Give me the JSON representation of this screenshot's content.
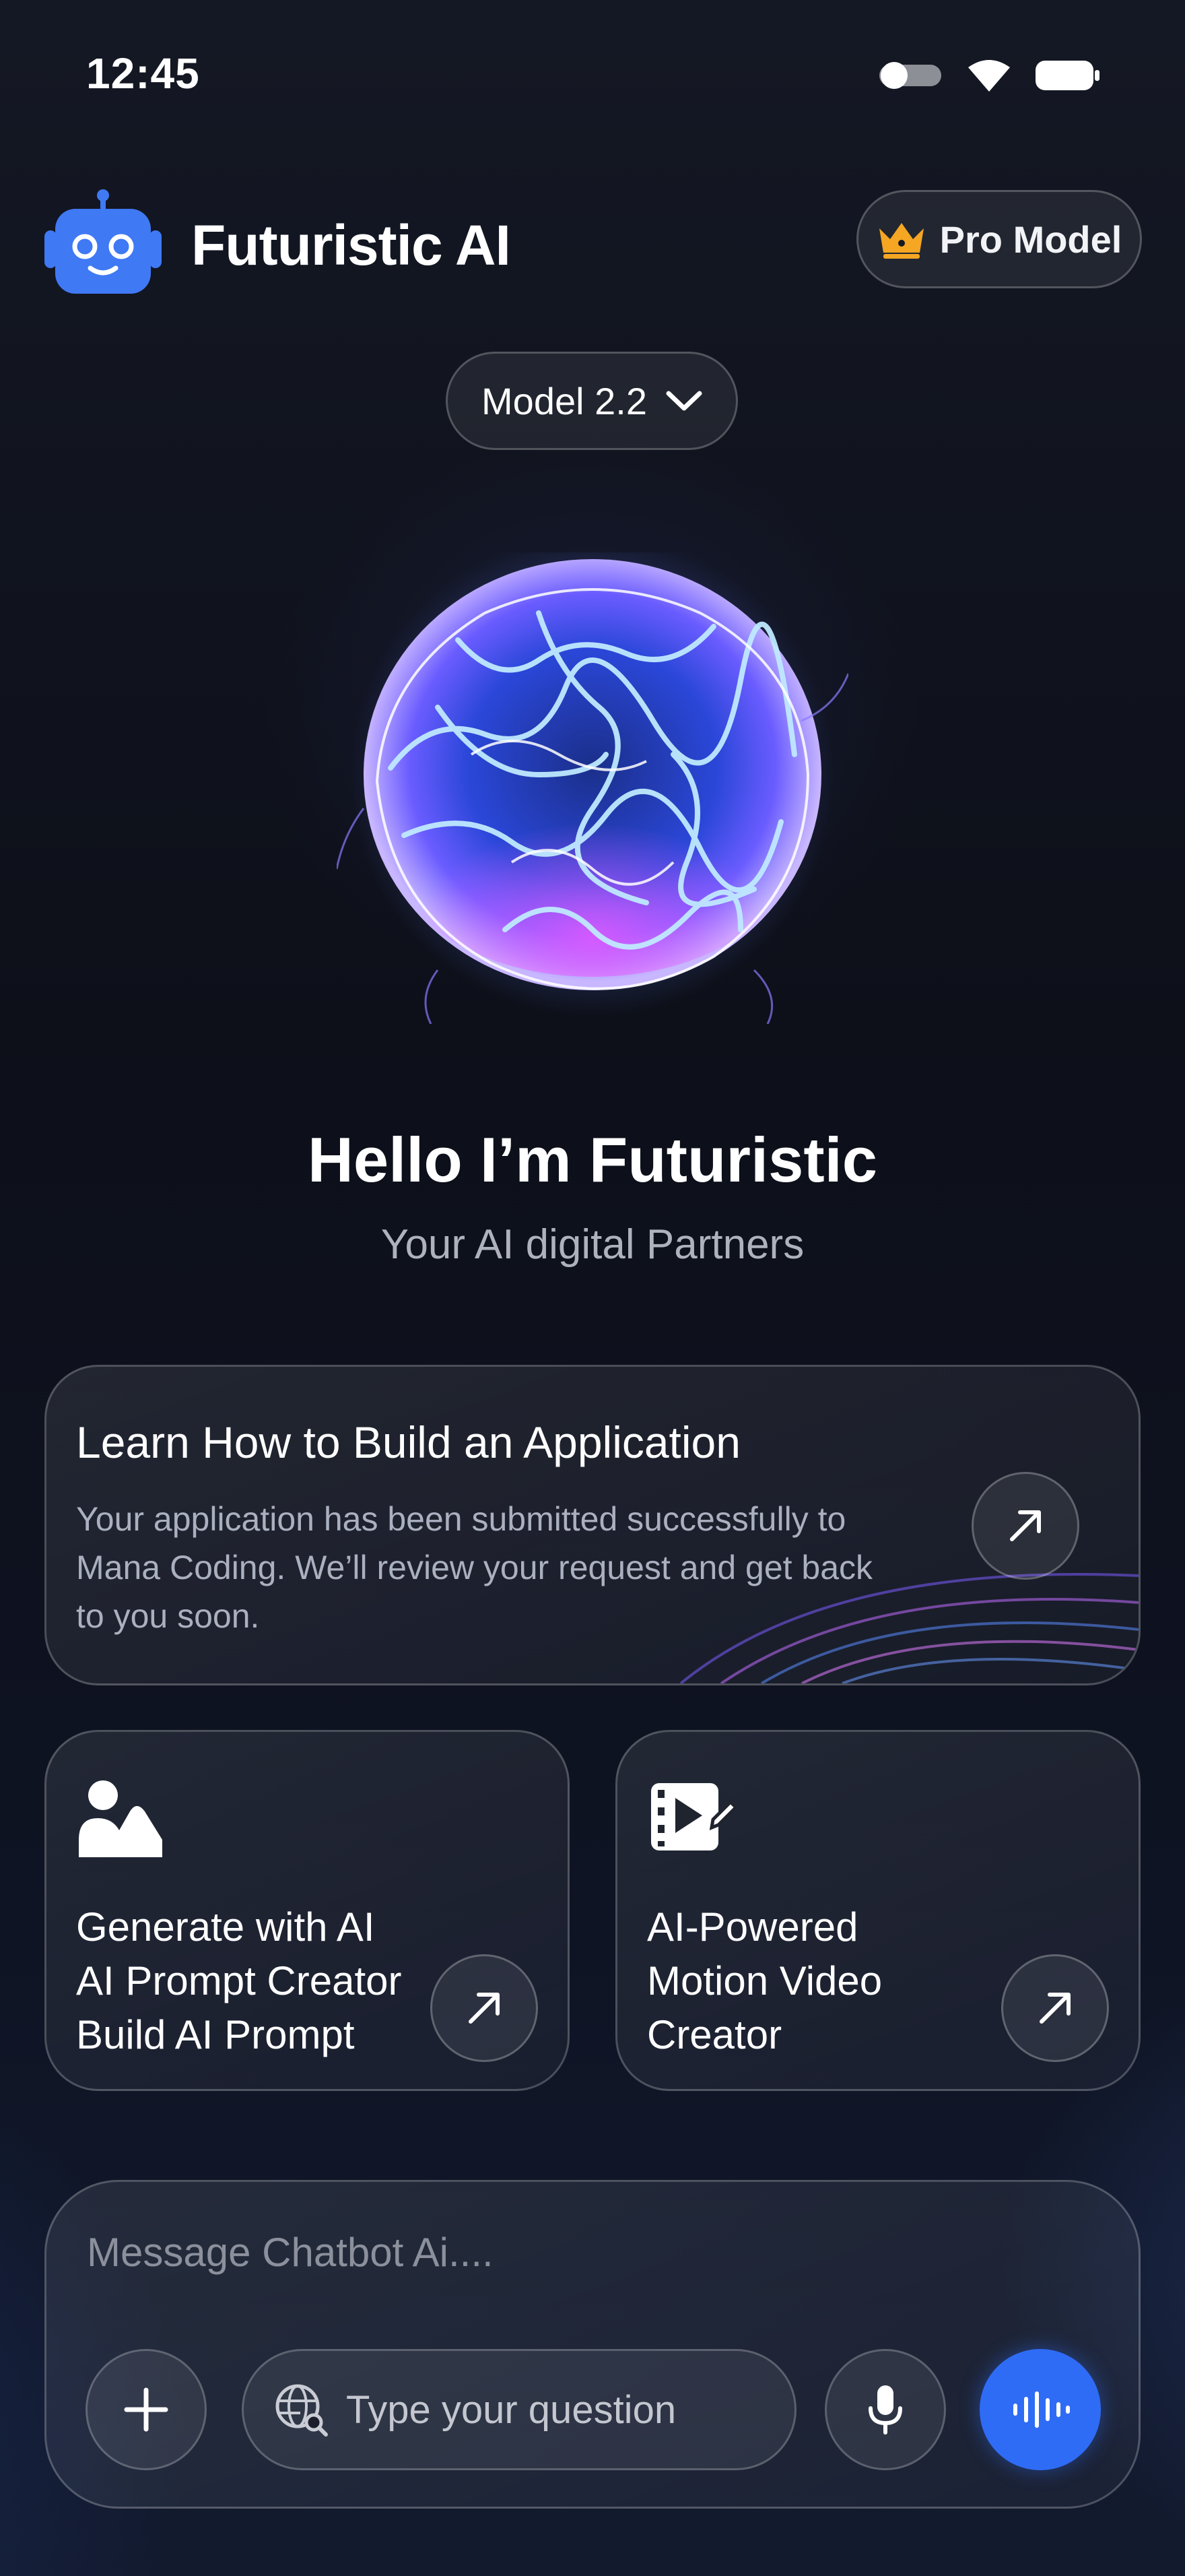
{
  "status_bar": {
    "time": "12:45"
  },
  "header": {
    "app_title": "Futuristic AI",
    "pro_button_label": "Pro Model"
  },
  "model_selector": {
    "label": "Model 2.2"
  },
  "hero": {
    "title": "Hello I’m Futuristic",
    "subtitle": "Your AI digital Partners"
  },
  "cards": {
    "wide": {
      "title": "Learn How to Build an Application",
      "description": "Your application has been submitted successfully to Mana Coding. We’ll review your request and get back to you soon."
    },
    "left": {
      "lines": [
        "Generate with AI",
        "AI Prompt Creator",
        "Build AI Prompt"
      ],
      "icon": "image-icon"
    },
    "right": {
      "lines": [
        "AI-Powered",
        "Motion Video",
        "Creator"
      ],
      "icon": "video-edit-icon"
    }
  },
  "composer": {
    "message_placeholder": "Message Chatbot Ai....",
    "question_placeholder": "Type your question"
  },
  "colors": {
    "accent": "#2f6cf6",
    "logo_blue": "#3f79f4",
    "crown": "#f5a623",
    "background": "#0d1019"
  }
}
